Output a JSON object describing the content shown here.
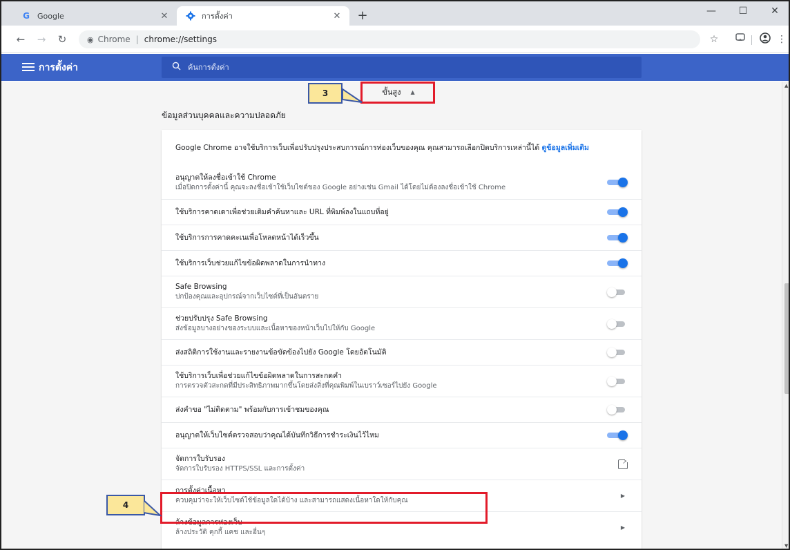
{
  "browser": {
    "tabs": [
      {
        "title": "Google",
        "favicon": "google-favicon"
      },
      {
        "title": "การตั้งค่า",
        "favicon": "settings-gear-favicon"
      }
    ],
    "window_controls": {
      "minimize": "—",
      "maximize": "☐",
      "close": "✕"
    },
    "address": {
      "chip": "Chrome",
      "url": "chrome://settings"
    }
  },
  "settings": {
    "title": "การตั้งค่า",
    "search_placeholder": "ค้นการตั้งค่า",
    "advanced_label": "ขั้นสูง",
    "section_title": "ข้อมูลส่วนบุคคลและความปลอดภัย",
    "intro": {
      "text": "Google Chrome อาจใช้บริการเว็บเพื่อปรับปรุงประสบการณ์การท่องเว็บของคุณ คุณสามารถเลือกปิดบริการเหล่านี้ได้",
      "link": "ดูข้อมูลเพิ่มเติม"
    },
    "rows": [
      {
        "primary": "อนุญาตให้ลงชื่อเข้าใช้ Chrome",
        "secondary": "เมื่อปิดการตั้งค่านี้ คุณจะลงชื่อเข้าใช้เว็บไซต์ของ Google อย่างเช่น Gmail ได้โดยไม่ต้องลงชื่อเข้าใช้ Chrome",
        "control": "toggle",
        "on": true
      },
      {
        "primary": "ใช้บริการคาดเดาเพื่อช่วยเติมคำค้นหาและ URL ที่พิมพ์ลงในแถบที่อยู่",
        "secondary": "",
        "control": "toggle",
        "on": true
      },
      {
        "primary": "ใช้บริการการคาดคะเนเพื่อโหลดหน้าได้เร็วขึ้น",
        "secondary": "",
        "control": "toggle",
        "on": true
      },
      {
        "primary": "ใช้บริการเว็บช่วยแก้ไขข้อผิดพลาดในการนำทาง",
        "secondary": "",
        "control": "toggle",
        "on": true
      },
      {
        "primary": "Safe Browsing",
        "secondary": "ปกป้องคุณและอุปกรณ์จากเว็บไซต์ที่เป็นอันตราย",
        "control": "toggle",
        "on": false
      },
      {
        "primary": "ช่วยปรับปรุง Safe Browsing",
        "secondary": "ส่งข้อมูลบางอย่างของระบบและเนื้อหาของหน้าเว็บไปให้กับ Google",
        "control": "toggle",
        "on": false
      },
      {
        "primary": "ส่งสถิติการใช้งานและรายงานข้อขัดข้องไปยัง Google โดยอัตโนมัติ",
        "secondary": "",
        "control": "toggle",
        "on": false
      },
      {
        "primary": "ใช้บริการเว็บเพื่อช่วยแก้ไขข้อผิดพลาดในการสะกดคำ",
        "secondary": "การตรวจตัวสะกดที่มีประสิทธิภาพมากขึ้นโดยส่งสิ่งที่คุณพิมพ์ในเบราว์เซอร์ไปยัง Google",
        "control": "toggle",
        "on": false
      },
      {
        "primary": "ส่งคำขอ \"ไม่ติดตาม\" พร้อมกับการเข้าชมของคุณ",
        "secondary": "",
        "control": "toggle",
        "on": false
      },
      {
        "primary": "อนุญาตให้เว็บไซต์ตรวจสอบว่าคุณได้บันทึกวิธีการชำระเงินไว้ไหม",
        "secondary": "",
        "control": "toggle",
        "on": true
      },
      {
        "primary": "จัดการใบรับรอง",
        "secondary": "จัดการใบรับรอง HTTPS/SSL และการตั้งค่า",
        "control": "external",
        "on": false
      },
      {
        "primary": "การตั้งค่าเนื้อหา",
        "secondary": "ควบคุมว่าจะให้เว็บไซต์ใช้ข้อมูลใดได้บ้าง และสามารถแสดงเนื้อหาใดให้กับคุณ",
        "control": "chevron",
        "on": false
      },
      {
        "primary": "ล้างข้อมูลการท่องเว็บ",
        "secondary": "ล้างประวัติ คุกกี้ แคช และอื่นๆ",
        "control": "chevron",
        "on": false
      }
    ]
  },
  "annotations": {
    "step3": "3",
    "step4": "4"
  },
  "colors": {
    "accent": "#1a73e8",
    "header": "#3c64c8",
    "callout_fill": "#fbe79a",
    "highlight": "#e21b2a"
  }
}
